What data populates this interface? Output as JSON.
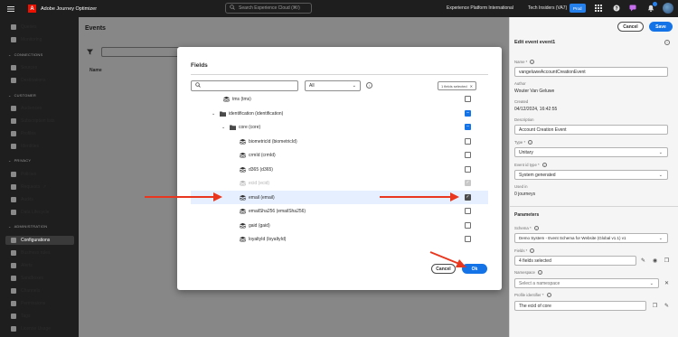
{
  "topbar": {
    "app_name": "Adobe Journey Optimizer",
    "search_placeholder": "Search Experience Cloud (⌘/)",
    "org": "Experience Platform International",
    "sandbox": "Tech Insiders (VA7)",
    "env_badge": "Prod",
    "icons": [
      "apps-grid-icon",
      "help-icon",
      "chat-icon",
      "bell-icon",
      "avatar"
    ]
  },
  "sidebar": {
    "items": [
      {
        "label": "Queries",
        "icon": "queries-icon"
      },
      {
        "label": "Monitoring",
        "icon": "monitoring-icon"
      },
      {
        "section": "CONNECTIONS"
      },
      {
        "label": "Sources",
        "icon": "sources-icon"
      },
      {
        "label": "Destinations",
        "icon": "destinations-icon"
      },
      {
        "section": "CUSTOMER"
      },
      {
        "label": "Audiences",
        "icon": "audiences-icon"
      },
      {
        "label": "Subscription lists",
        "icon": "subscription-icon"
      },
      {
        "label": "Profiles",
        "icon": "profiles-icon"
      },
      {
        "label": "Identities",
        "icon": "identities-icon"
      },
      {
        "section": "PRIVACY"
      },
      {
        "label": "Policies",
        "icon": "policies-icon"
      },
      {
        "label": "Requests",
        "icon": "requests-icon"
      },
      {
        "label": "Audits",
        "icon": "audits-icon"
      },
      {
        "label": "Data Lifecycle",
        "icon": "data-lifecycle-icon"
      },
      {
        "section": "ADMINISTRATION"
      },
      {
        "label": "Configurations",
        "icon": "configurations-icon",
        "active": true
      },
      {
        "label": "Business rules",
        "icon": "business-rules-icon"
      },
      {
        "label": "Alerts",
        "icon": "alerts-icon"
      },
      {
        "label": "Sandboxes",
        "icon": "sandboxes-icon"
      },
      {
        "label": "Channels",
        "icon": "channels-icon"
      },
      {
        "label": "Permissions",
        "icon": "permissions-icon"
      },
      {
        "label": "Tags",
        "icon": "tags-icon"
      },
      {
        "label": "License Usage",
        "icon": "license-icon"
      }
    ]
  },
  "main": {
    "title": "Events",
    "column_name": "Name"
  },
  "right_panel": {
    "cancel_label": "Cancel",
    "save_label": "Save",
    "title": "Edit event event1",
    "name_label": "Name",
    "name_value": "vangeluweAccountCreationEvent",
    "author_label": "Author",
    "author_value": "Wouter Van Geluwe",
    "created_label": "Created",
    "created_value": "04/12/2024, 16:42:55",
    "description_label": "Description",
    "description_value": "Account Creation Event",
    "type_label": "Type",
    "type_value": "Unitary",
    "event_id_type_label": "Event id type",
    "event_id_type_value": "System generated",
    "used_in_label": "Used in",
    "used_in_value": "0 journeys",
    "parameters_heading": "Parameters",
    "schema_label": "Schema",
    "schema_value": "Demo System - Event Schema for Website (Global v1.1) v1",
    "fields_label": "Fields",
    "fields_value": "4 fields selected",
    "namespace_label": "Namespace",
    "namespace_placeholder": "Select a namespace",
    "profile_identifier_label": "Profile identifier",
    "profile_identifier_value": "The ecid of core"
  },
  "modal": {
    "title": "Fields",
    "filter_value": "All",
    "selected_badge": "1 fields selected",
    "cancel_label": "Cancel",
    "ok_label": "Ok",
    "rows": [
      {
        "label": "tms (tms)",
        "indent": 0,
        "icon": "field-group",
        "check": "none"
      },
      {
        "label": "identification (identification)",
        "indent": 1,
        "icon": "folder",
        "twisty": "v",
        "check": "partial"
      },
      {
        "label": "core (core)",
        "indent": 2,
        "icon": "folder",
        "twisty": "v",
        "check": "partial"
      },
      {
        "label": "biometricId (biometricId)",
        "indent": 3,
        "icon": "field-group",
        "check": "none"
      },
      {
        "label": "crmId (crmId)",
        "indent": 3,
        "icon": "field-group",
        "check": "none"
      },
      {
        "label": "d365 (d365)",
        "indent": 3,
        "icon": "field-group",
        "check": "none"
      },
      {
        "label": "ecid (ecid)",
        "indent": 3,
        "icon": "field-group",
        "check": "disabled",
        "disabled": true
      },
      {
        "label": "email (email)",
        "indent": 3,
        "icon": "field-group",
        "check": "checked",
        "highlight": true
      },
      {
        "label": "emailSha256 (emailSha256)",
        "indent": 3,
        "icon": "field-group",
        "check": "none"
      },
      {
        "label": "gaid (gaid)",
        "indent": 3,
        "icon": "field-group",
        "check": "none"
      },
      {
        "label": "loyaltyId (loyaltyId)",
        "indent": 3,
        "icon": "field-group",
        "check": "none"
      }
    ]
  }
}
